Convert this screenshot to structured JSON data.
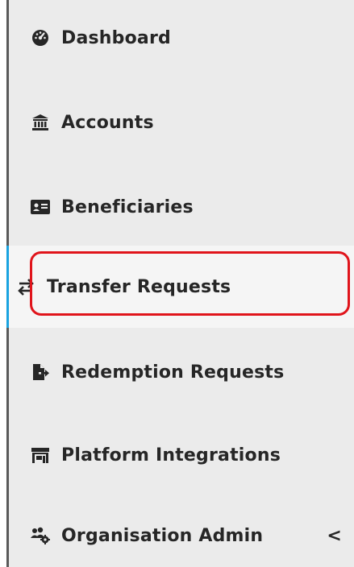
{
  "sidebar": {
    "items": [
      {
        "label": "Dashboard",
        "icon": "dashboard-gauge-icon"
      },
      {
        "label": "Accounts",
        "icon": "bank-icon"
      },
      {
        "label": "Beneficiaries",
        "icon": "id-card-icon"
      },
      {
        "label": "Transfer Requests",
        "icon": "exchange-arrows-icon",
        "active": true
      },
      {
        "label": "Redemption Requests",
        "icon": "file-export-icon"
      },
      {
        "label": "Platform Integrations",
        "icon": "store-icon"
      },
      {
        "label": "Organisation Admin",
        "icon": "users-cog-icon",
        "expand": "<"
      }
    ]
  },
  "colors": {
    "active_bar": "#1aa3e0",
    "highlight_border": "#e0141b",
    "sidebar_bg": "#ebebeb"
  }
}
